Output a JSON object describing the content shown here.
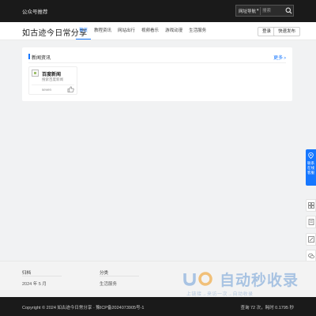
{
  "topbar": {
    "notice": "公众号推荐",
    "search_scope": "网址导航",
    "search_placeholder": "搜索"
  },
  "header": {
    "site_title": "如古迹今日常分享",
    "nav": [
      "首页",
      "教程资讯",
      "网站出行",
      "视频看乐",
      "游戏动漫",
      "生活服务"
    ],
    "active_nav": "首页",
    "login_label": "登录",
    "quick_post_label": "快速发布"
  },
  "card": {
    "title": "新闻资讯",
    "more_label": "更多",
    "item": {
      "name": "百度新闻",
      "desc": "搜索百度新闻",
      "user": "seven"
    }
  },
  "float_tools": {
    "contact_label_line1": "联系",
    "contact_label_line2": "在线",
    "contact_label_line3": "客服"
  },
  "footer": {
    "col1_title": "归档",
    "col1_value": "2024 年 5 月",
    "col2_title": "分类",
    "col2_value": "生活服务"
  },
  "watermark": {
    "text": "自动秒收录",
    "sub": "上链接→来访一次→自动收录"
  },
  "copyright": {
    "left": "Copyright © 2024 如古迹今日常分享 · 豫ICP备2024073905号-1",
    "right": "查询 72 次，耗时 0.1795 秒"
  },
  "colors": {
    "accent": "#1677ff",
    "topbar_bg": "#1a1a1a",
    "page_bg": "#f1f2f3"
  }
}
